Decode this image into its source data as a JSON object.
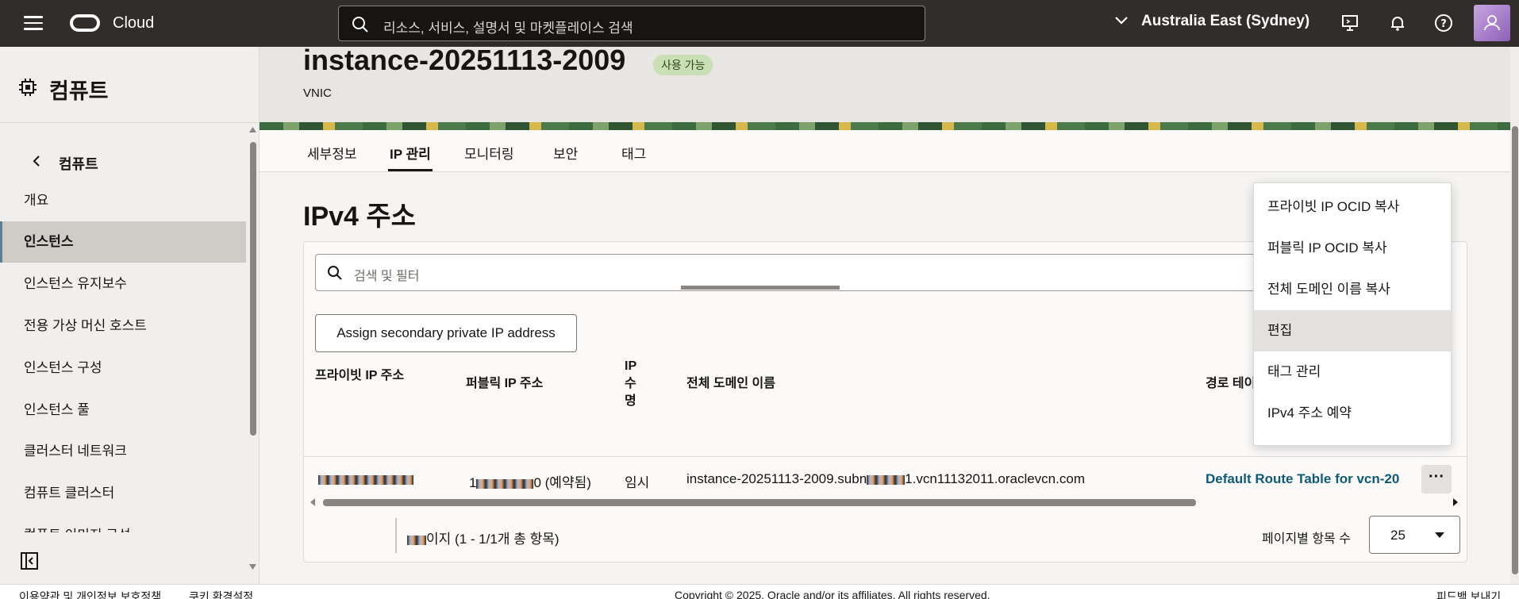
{
  "topbar": {
    "brand": "Cloud",
    "search_placeholder": "리소스, 서비스, 설명서 및 마켓플레이스 검색",
    "region": "Australia East (Sydney)"
  },
  "sidebar": {
    "title": "컴퓨트",
    "back_label": "컴퓨트",
    "items": [
      {
        "label": "개요"
      },
      {
        "label": "인스턴스"
      },
      {
        "label": "인스턴스 유지보수"
      },
      {
        "label": "전용 가상 머신 호스트"
      },
      {
        "label": "인스턴스 구성"
      },
      {
        "label": "인스턴스 풀"
      },
      {
        "label": "클러스터 네트워크"
      },
      {
        "label": "컴퓨트 클러스터"
      },
      {
        "label": "컴퓨트 이미지 구성"
      }
    ]
  },
  "header": {
    "title": "instance-20251113-2009",
    "status": "사용 가능",
    "subtitle": "VNIC"
  },
  "tabs": [
    {
      "label": "세부정보"
    },
    {
      "label": "IP 관리"
    },
    {
      "label": "모니터링"
    },
    {
      "label": "보안"
    },
    {
      "label": "태그"
    }
  ],
  "section": {
    "title": "IPv4 주소",
    "filter_placeholder": "검색 및 필터",
    "assign_button": "Assign secondary private IP address"
  },
  "table": {
    "headers": [
      "프라이빗 IP 주소",
      "퍼블릭 IP 주소",
      "IP 수명",
      "전체 도메인 이름",
      "경로 테이블"
    ],
    "row": {
      "public_ip_suffix": "0 (예약됨)",
      "public_ip_prefix": "1",
      "lifetime": "임시",
      "fqdn_prefix": "instance-20251113-2009.subn",
      "fqdn_suffix": "1.vcn11132011.oraclevcn.com",
      "route_table": "Default Route Table for vcn-20"
    },
    "more_label": "···"
  },
  "pager": {
    "text": "이지 (1 - 1/1개 총 항목)",
    "per_page_label": "페이지별 항목 수",
    "per_page_value": "25"
  },
  "menu": {
    "items": [
      {
        "label": "프라이빗 IP OCID 복사"
      },
      {
        "label": "퍼블릭 IP OCID 복사"
      },
      {
        "label": "전체 도메인 이름 복사"
      },
      {
        "label": "편집"
      },
      {
        "label": "태그 관리"
      },
      {
        "label": "IPv4 주소 예약"
      }
    ]
  },
  "footer": {
    "left": "이용약관 및 개인정보 보호정책",
    "cookie": "쿠키 환경설정",
    "copyright": "Copyright © 2025, Oracle and/or its affiliates. All rights reserved.",
    "feedback": "피드백 보내기"
  }
}
